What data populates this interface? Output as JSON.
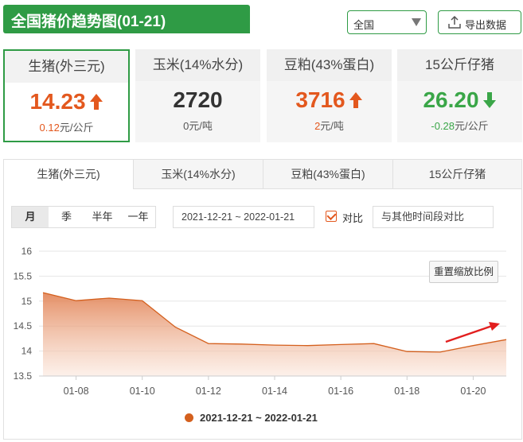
{
  "header": {
    "title": "全国猪价趋势图(01-21)",
    "region": "全国",
    "export_label": "导出数据"
  },
  "cards": [
    {
      "name": "生猪(外三元)",
      "value": "14.23",
      "change_num": "0.12",
      "change_unit": "元/公斤",
      "trend": "up"
    },
    {
      "name": "玉米(14%水分)",
      "value": "2720",
      "change_num": "0",
      "change_unit": "元/吨",
      "trend": "flat"
    },
    {
      "name": "豆粕(43%蛋白)",
      "value": "3716",
      "change_num": "2",
      "change_unit": "元/吨",
      "trend": "up"
    },
    {
      "name": "15公斤仔猪",
      "value": "26.20",
      "change_num": "-0.28",
      "change_unit": "元/公斤",
      "trend": "down"
    }
  ],
  "tabs": [
    "生猪(外三元)",
    "玉米(14%水分)",
    "豆粕(43%蛋白)",
    "15公斤仔猪"
  ],
  "periods": [
    "月",
    "季",
    "半年",
    "一年"
  ],
  "date_range": "2021-12-21 ~ 2022-01-21",
  "compare_label": "对比",
  "compare_placeholder": "与其他时间段对比",
  "reset_label": "重置缩放比例",
  "colors": {
    "brand": "#2f9b45",
    "up": "#e3581e",
    "down": "#3aa648",
    "series": "#d4601e"
  },
  "chart_data": {
    "type": "area",
    "x": [
      "01-07",
      "01-08",
      "01-09",
      "01-10",
      "01-11",
      "01-12",
      "01-13",
      "01-14",
      "01-15",
      "01-16",
      "01-17",
      "01-18",
      "01-19",
      "01-20",
      "01-21"
    ],
    "xticks": [
      "01-08",
      "01-10",
      "01-12",
      "01-14",
      "01-16",
      "01-18",
      "01-20"
    ],
    "yticks": [
      "16",
      "15.5",
      "15",
      "14.5",
      "14",
      "13.5"
    ],
    "ylim": [
      13.5,
      16
    ],
    "series": [
      {
        "name": "2021-12-21 ~ 2022-01-21",
        "values": [
          15.17,
          15.01,
          15.06,
          15.01,
          14.48,
          14.15,
          14.14,
          14.12,
          14.11,
          14.13,
          14.15,
          13.99,
          13.98,
          14.11,
          14.23
        ]
      }
    ]
  }
}
